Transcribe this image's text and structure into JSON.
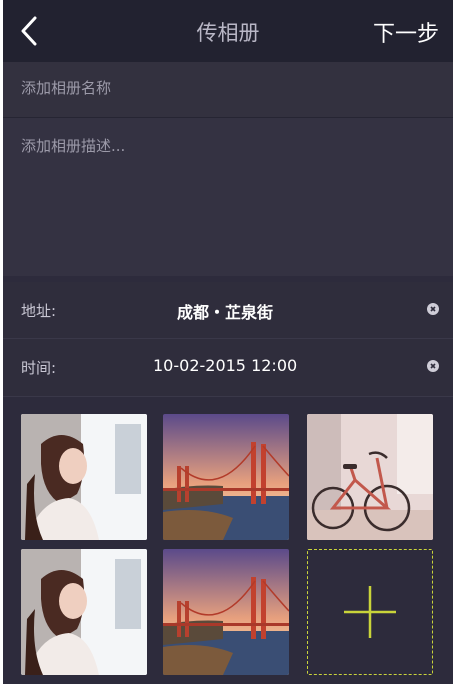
{
  "navbar": {
    "back_icon": "chevron-left-icon",
    "title": "传相册",
    "next_label": "下一步"
  },
  "form": {
    "name_placeholder": "添加相册名称",
    "desc_placeholder": "添加相册描述..."
  },
  "address": {
    "label": "地址:",
    "value": "成都・芷泉街",
    "clear_icon": "clear-circle-icon"
  },
  "time": {
    "label": "时间:",
    "value": "10-02-2015  12:00",
    "clear_icon": "clear-circle-icon"
  },
  "photos": [
    {
      "subject": "portrait-woman"
    },
    {
      "subject": "golden-gate-bridge"
    },
    {
      "subject": "bicycle"
    },
    {
      "subject": "portrait-woman"
    },
    {
      "subject": "golden-gate-bridge"
    }
  ],
  "add_tile": {
    "icon": "plus-icon",
    "accent_color": "#c9d43a"
  },
  "colors": {
    "background": "#2d2b3c",
    "navbar": "#222230"
  }
}
